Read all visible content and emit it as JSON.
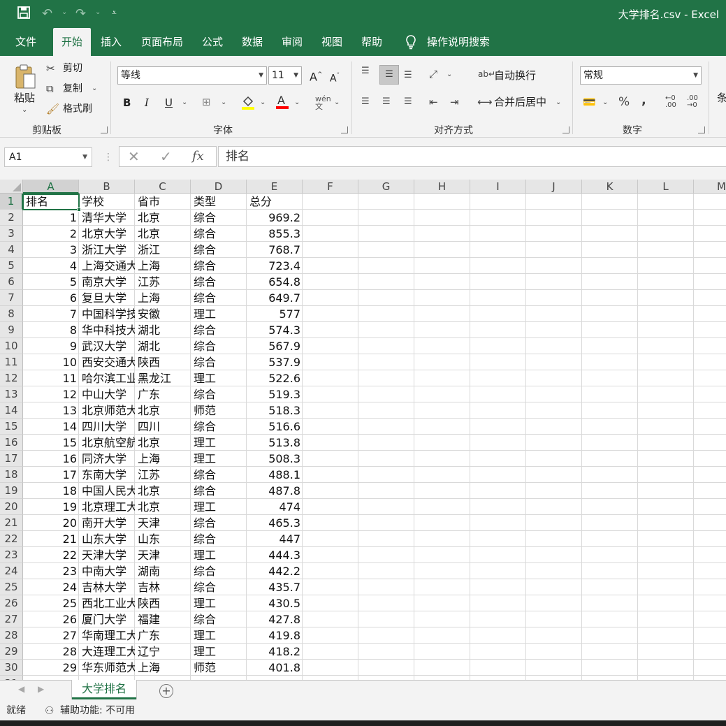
{
  "window": {
    "title": "大学排名.csv  -  Excel"
  },
  "tabs": [
    {
      "label": "文件"
    },
    {
      "label": "开始"
    },
    {
      "label": "插入"
    },
    {
      "label": "页面布局"
    },
    {
      "label": "公式"
    },
    {
      "label": "数据"
    },
    {
      "label": "审阅"
    },
    {
      "label": "视图"
    },
    {
      "label": "帮助"
    }
  ],
  "tellme": {
    "label": "操作说明搜索"
  },
  "ribbon": {
    "clipboard": {
      "paste": "粘贴",
      "cut": "剪切",
      "copy": "复制",
      "format_painter": "格式刷",
      "label": "剪贴板"
    },
    "font": {
      "name": "等线",
      "size": "11",
      "label": "字体",
      "underline_color": "#ff0000",
      "fill_color": "#ffff00"
    },
    "alignment": {
      "wrap": "自动换行",
      "merge": "合并后居中",
      "label": "对齐方式"
    },
    "number": {
      "format": "常规",
      "label": "数字"
    },
    "styles": {
      "partial": "条"
    }
  },
  "formula_bar": {
    "name_box": "A1",
    "content": "排名"
  },
  "columns": [
    "A",
    "B",
    "C",
    "D",
    "E",
    "F",
    "G",
    "H",
    "I",
    "J",
    "K",
    "L",
    "M"
  ],
  "rows": [
    "1",
    "2",
    "3",
    "4",
    "5",
    "6",
    "7",
    "8",
    "9",
    "10",
    "11",
    "12",
    "13",
    "14",
    "15",
    "16",
    "17",
    "18",
    "19",
    "20",
    "21",
    "22",
    "23",
    "24",
    "25",
    "26",
    "27",
    "28",
    "29",
    "30",
    "31"
  ],
  "table": {
    "headers": [
      "排名",
      "学校",
      "省市",
      "类型",
      "总分"
    ],
    "rows": [
      [
        "1",
        "清华大学",
        "北京",
        "综合",
        "969.2"
      ],
      [
        "2",
        "北京大学",
        "北京",
        "综合",
        "855.3"
      ],
      [
        "3",
        "浙江大学",
        "浙江",
        "综合",
        "768.7"
      ],
      [
        "4",
        "上海交通大学",
        "上海",
        "综合",
        "723.4"
      ],
      [
        "5",
        "南京大学",
        "江苏",
        "综合",
        "654.8"
      ],
      [
        "6",
        "复旦大学",
        "上海",
        "综合",
        "649.7"
      ],
      [
        "7",
        "中国科学技术大学",
        "安徽",
        "理工",
        "577"
      ],
      [
        "8",
        "华中科技大学",
        "湖北",
        "综合",
        "574.3"
      ],
      [
        "9",
        "武汉大学",
        "湖北",
        "综合",
        "567.9"
      ],
      [
        "10",
        "西安交通大学",
        "陕西",
        "综合",
        "537.9"
      ],
      [
        "11",
        "哈尔滨工业大学",
        "黑龙江",
        "理工",
        "522.6"
      ],
      [
        "12",
        "中山大学",
        "广东",
        "综合",
        "519.3"
      ],
      [
        "13",
        "北京师范大学",
        "北京",
        "师范",
        "518.3"
      ],
      [
        "14",
        "四川大学",
        "四川",
        "综合",
        "516.6"
      ],
      [
        "15",
        "北京航空航天大学",
        "北京",
        "理工",
        "513.8"
      ],
      [
        "16",
        "同济大学",
        "上海",
        "理工",
        "508.3"
      ],
      [
        "17",
        "东南大学",
        "江苏",
        "综合",
        "488.1"
      ],
      [
        "18",
        "中国人民大学",
        "北京",
        "综合",
        "487.8"
      ],
      [
        "19",
        "北京理工大学",
        "北京",
        "理工",
        "474"
      ],
      [
        "20",
        "南开大学",
        "天津",
        "综合",
        "465.3"
      ],
      [
        "21",
        "山东大学",
        "山东",
        "综合",
        "447"
      ],
      [
        "22",
        "天津大学",
        "天津",
        "理工",
        "444.3"
      ],
      [
        "23",
        "中南大学",
        "湖南",
        "综合",
        "442.2"
      ],
      [
        "24",
        "吉林大学",
        "吉林",
        "综合",
        "435.7"
      ],
      [
        "25",
        "西北工业大学",
        "陕西",
        "理工",
        "430.5"
      ],
      [
        "26",
        "厦门大学",
        "福建",
        "综合",
        "427.8"
      ],
      [
        "27",
        "华南理工大学",
        "广东",
        "理工",
        "419.8"
      ],
      [
        "28",
        "大连理工大学",
        "辽宁",
        "理工",
        "418.2"
      ],
      [
        "29",
        "华东师范大学",
        "上海",
        "师范",
        "401.8"
      ]
    ]
  },
  "sheet": {
    "name": "大学排名"
  },
  "status": {
    "ready": "就绪",
    "accessibility": "辅助功能: 不可用"
  },
  "colors": {
    "brand": "#217346"
  }
}
